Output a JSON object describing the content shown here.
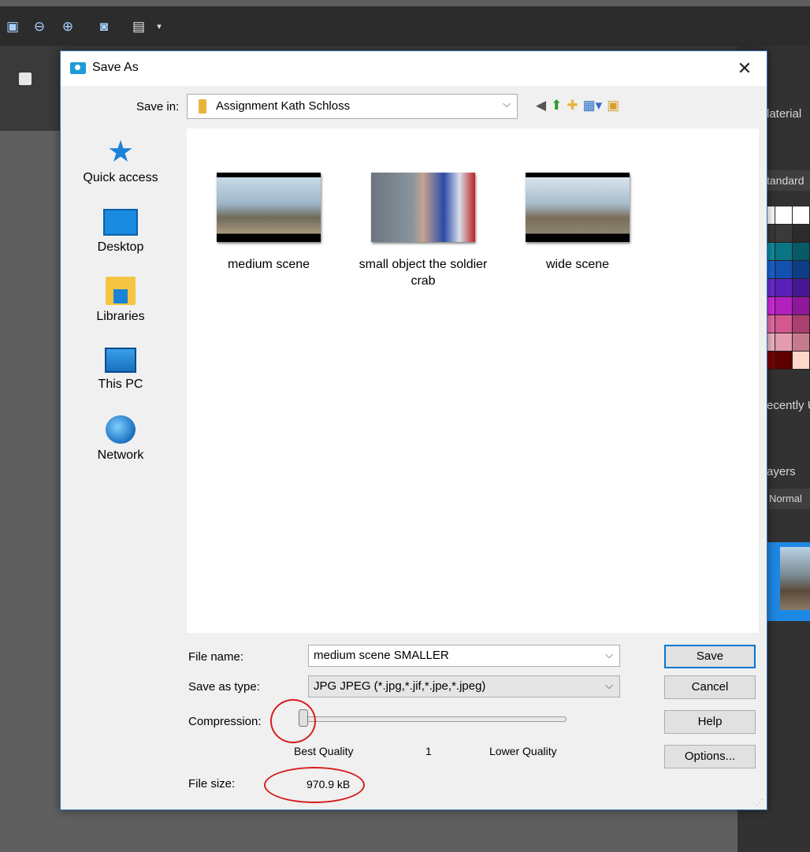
{
  "app": {
    "right_panel": {
      "materials_title": "laterial",
      "materials_dropdown": "tandard",
      "recently_label": "ecently U",
      "layers_title": "ayers",
      "layers_blend": "Normal"
    },
    "swatches": [
      "#ffffff",
      "#ffffff",
      "#ffffff",
      "#3a3a3a",
      "#3a3a3a",
      "#2b2b2b",
      "#0f8fa0",
      "#0b7585",
      "#085a66",
      "#1a63d6",
      "#1450b0",
      "#0e3c85",
      "#6b2bd6",
      "#5a1fb8",
      "#451793",
      "#d42be0",
      "#b41fc0",
      "#8f1799",
      "#e86fa8",
      "#d4588f",
      "#ab3f6e",
      "#f0b8c8",
      "#e49aaf",
      "#c77a8e",
      "#7a0000",
      "#5e0000",
      "#ffd6c8"
    ]
  },
  "dialog": {
    "title": "Save As",
    "close_glyph": "✕",
    "save_in_label": "Save in:",
    "save_in_value": "Assignment Kath Schloss",
    "places": [
      {
        "label": "Quick access"
      },
      {
        "label": "Desktop"
      },
      {
        "label": "Libraries"
      },
      {
        "label": "This PC"
      },
      {
        "label": "Network"
      }
    ],
    "files": [
      {
        "label": "medium scene"
      },
      {
        "label": "small object the soldier crab"
      },
      {
        "label": "wide scene"
      }
    ],
    "file_name_label": "File name:",
    "file_name_value": "medium scene SMALLER",
    "save_type_label": "Save as type:",
    "save_type_value": "JPG JPEG (*.jpg,*.jif,*.jpe,*.jpeg)",
    "compression_label": "Compression:",
    "compression_value": 1,
    "compression_min_label": "Best Quality",
    "compression_max_label": "Lower Quality",
    "file_size_label": "File size:",
    "file_size_value": "970.9 kB",
    "buttons": {
      "save": "Save",
      "cancel": "Cancel",
      "help": "Help",
      "options": "Options..."
    },
    "annotation_color": "#d71d1d",
    "accent_color": "#0078d7"
  }
}
